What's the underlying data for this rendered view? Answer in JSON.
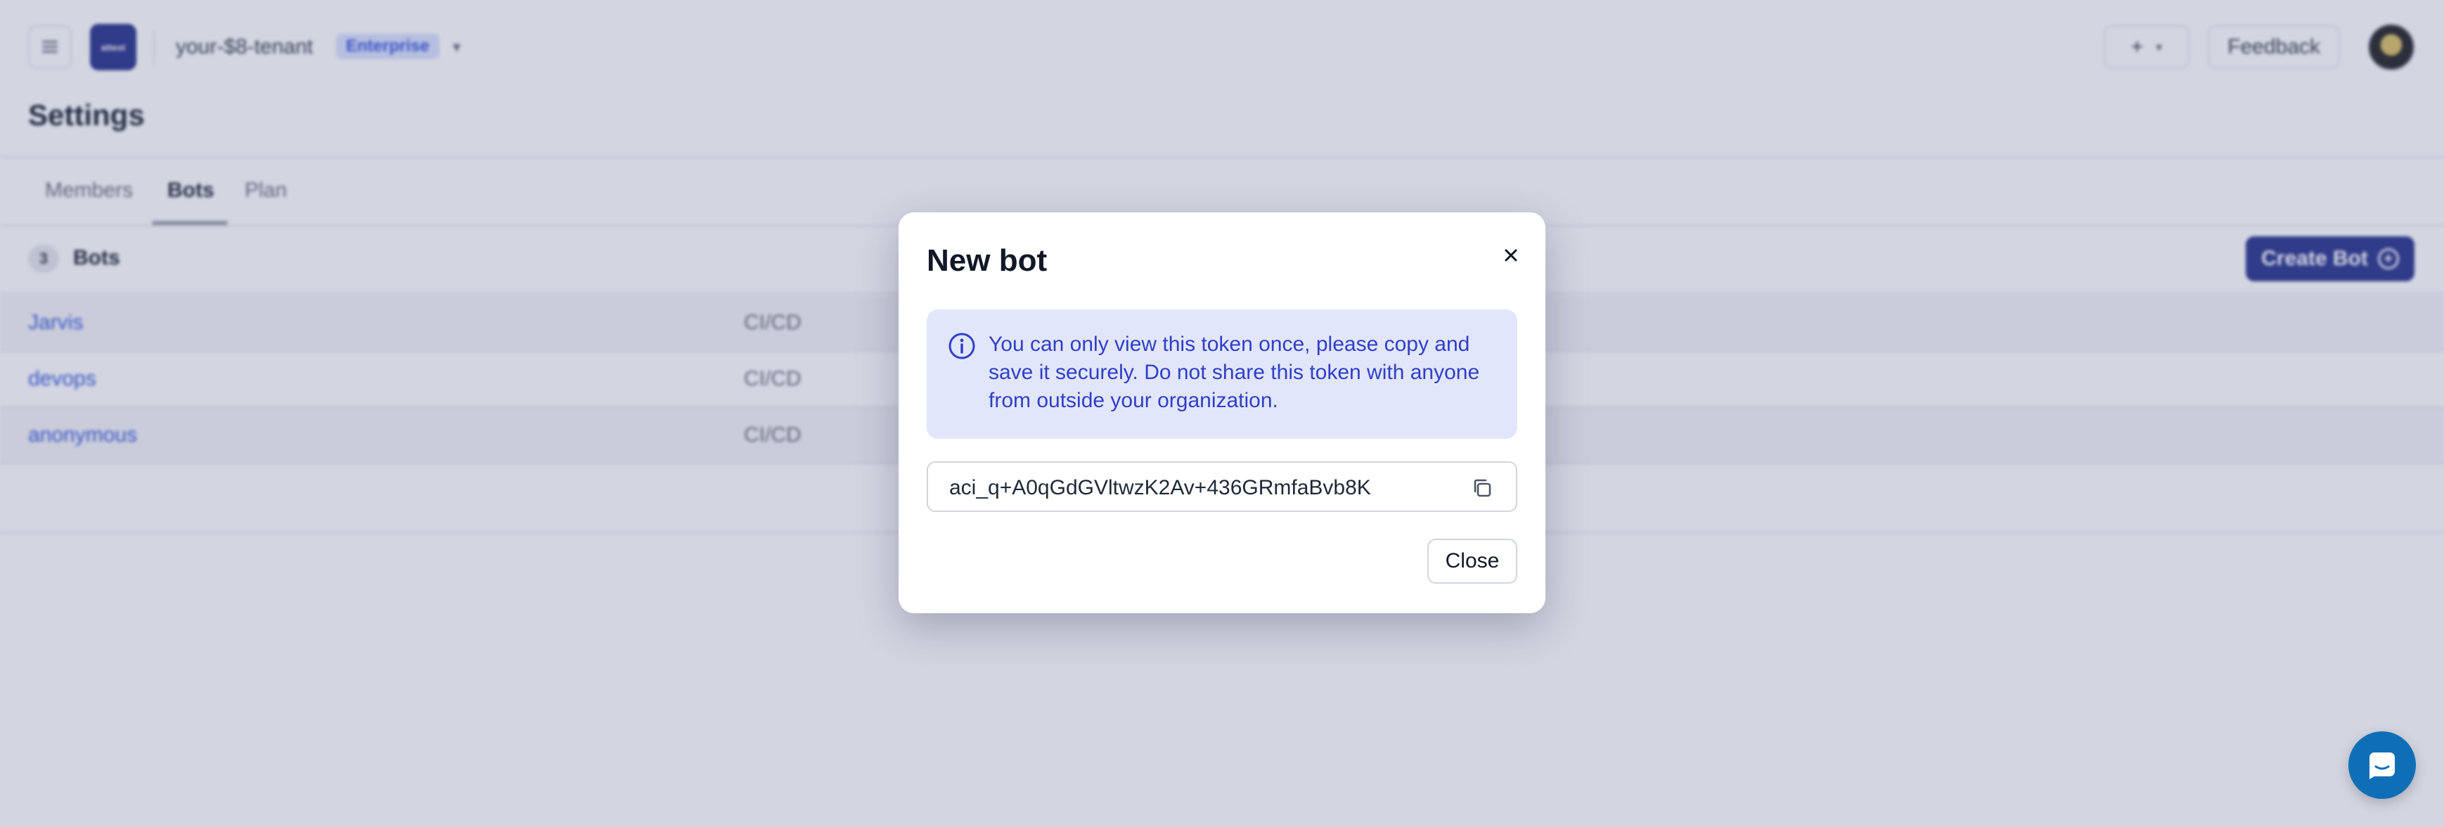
{
  "header": {
    "logo_text": "attest",
    "tenant_name": "your-$8-tenant",
    "tenant_badge": "Enterprise",
    "quick_add_symbol": "+",
    "feedback_label": "Feedback"
  },
  "page": {
    "title": "Settings"
  },
  "tabs": [
    {
      "label": "Members",
      "active": false
    },
    {
      "label": "Bots",
      "active": true
    },
    {
      "label": "Plan",
      "active": false
    }
  ],
  "bots_section": {
    "count": "3",
    "label": "Bots",
    "create_label": "Create Bot"
  },
  "bots": [
    {
      "name": "Jarvis",
      "type": "CI/CD"
    },
    {
      "name": "devops",
      "type": "CI/CD"
    },
    {
      "name": "anonymous",
      "type": "CI/CD"
    }
  ],
  "modal": {
    "title": "New bot",
    "notice": "You can only view this token once, please copy and save it securely. Do not share this token with anyone from outside your organization.",
    "token": "aci_q+A0qGdGVltwzK2Av+436GRmfaBvb8K",
    "close_label": "Close"
  },
  "colors": {
    "accent": "#2f3a8f",
    "notice_bg": "#e2e6fa",
    "notice_text": "#2f3fc7",
    "chat_launcher": "#0f6fb6"
  },
  "icons": {
    "menu": "menu-icon",
    "tenant_dropdown": "chevron-down-icon",
    "modal_close": "close-icon",
    "notice": "info-icon",
    "copy": "copy-icon",
    "chat": "chat-icon",
    "create_bot": "plus-circle-icon"
  }
}
